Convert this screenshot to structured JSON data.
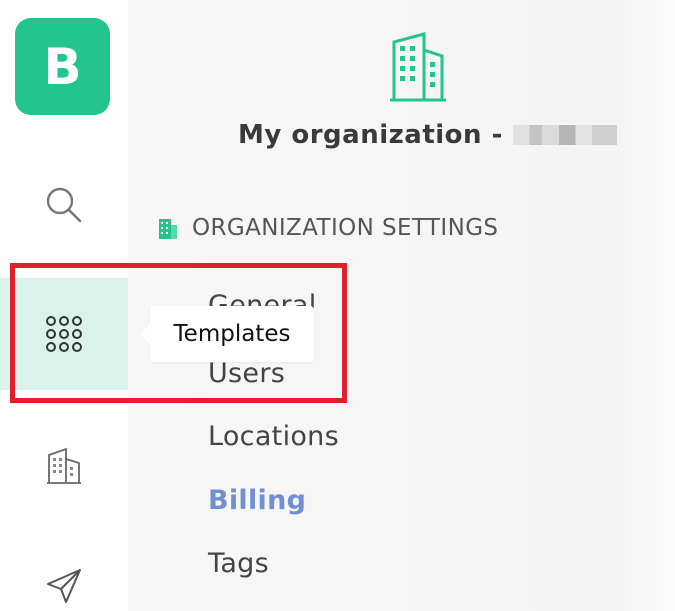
{
  "app": {
    "logo_letter": "B",
    "brand_color": "#23c48e"
  },
  "rail": {
    "items": [
      {
        "name": "search",
        "icon": "search-icon"
      },
      {
        "name": "templates",
        "icon": "grid-icon",
        "active": true
      },
      {
        "name": "organization",
        "icon": "building-icon"
      },
      {
        "name": "send",
        "icon": "paper-plane-icon"
      }
    ],
    "active_bg": "#d9f3ea"
  },
  "tooltip": {
    "label": "Templates"
  },
  "panel": {
    "org_name": "My organization -",
    "section_title": "ORGANIZATION SETTINGS",
    "nav": [
      {
        "label": "General"
      },
      {
        "label": "Users"
      },
      {
        "label": "Locations"
      },
      {
        "label": "Billing",
        "active": true,
        "color": "#6f8fd1"
      },
      {
        "label": "Tags"
      }
    ]
  },
  "annotation": {
    "highlight_color": "#e0212d"
  }
}
